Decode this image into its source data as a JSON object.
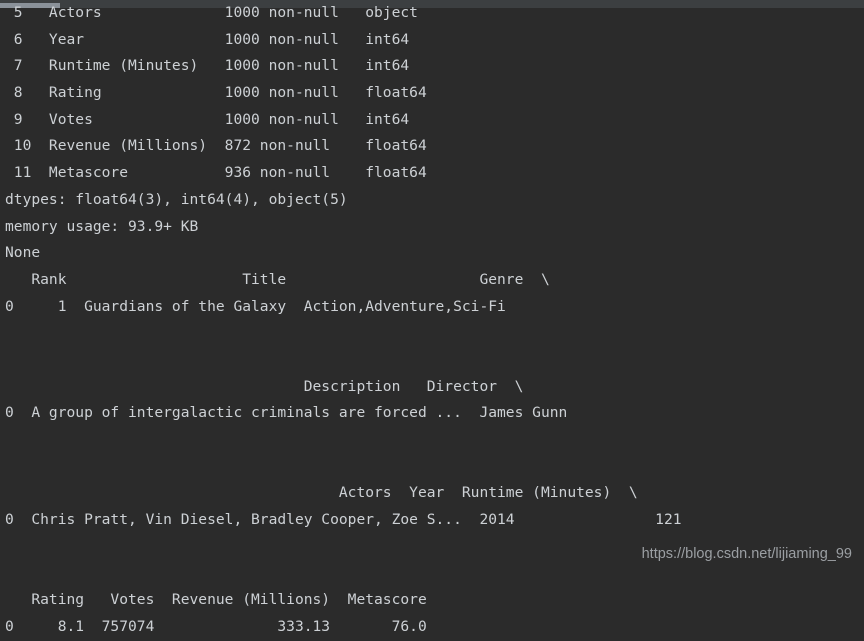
{
  "window": {
    "background_color": "#2b2b2b",
    "text_color": "#cdd1d5",
    "kind": "console-output"
  },
  "scrollbar": {
    "orientation": "horizontal",
    "track_color": "#3c3f41",
    "thumb_color": "#8a9199",
    "thumb_position_pct": 0,
    "thumb_width_pct": 7
  },
  "watermark": {
    "text": "https://blog.csdn.net/lijiaming_99",
    "color": "#9b9fa3"
  },
  "console": {
    "lines": [
      " 5   Actors              1000 non-null   object",
      " 6   Year                1000 non-null   int64",
      " 7   Runtime (Minutes)   1000 non-null   int64",
      " 8   Rating              1000 non-null   float64",
      " 9   Votes               1000 non-null   int64",
      " 10  Revenue (Millions)  872 non-null    float64",
      " 11  Metascore           936 non-null    float64",
      "dtypes: float64(3), int64(4), object(5)",
      "memory usage: 93.9+ KB",
      "None",
      "   Rank                    Title                      Genre  \\",
      "0     1  Guardians of the Galaxy  Action,Adventure,Sci-Fi",
      "",
      "",
      "                                  Description   Director  \\",
      "0  A group of intergalactic criminals are forced ...  James Gunn",
      "",
      "",
      "                                      Actors  Year  Runtime (Minutes)  \\",
      "0  Chris Pratt, Vin Diesel, Bradley Cooper, Zoe S...  2014                121",
      "",
      "",
      "   Rating   Votes  Revenue (Millions)  Metascore",
      "0     8.1  757074              333.13       76.0"
    ],
    "dataframe_info": {
      "columns": [
        {
          "index": "5",
          "name": "Actors",
          "non_null": "1000 non-null",
          "dtype": "object"
        },
        {
          "index": "6",
          "name": "Year",
          "non_null": "1000 non-null",
          "dtype": "int64"
        },
        {
          "index": "7",
          "name": "Runtime (Minutes)",
          "non_null": "1000 non-null",
          "dtype": "int64"
        },
        {
          "index": "8",
          "name": "Rating",
          "non_null": "1000 non-null",
          "dtype": "float64"
        },
        {
          "index": "9",
          "name": "Votes",
          "non_null": "1000 non-null",
          "dtype": "int64"
        },
        {
          "index": "10",
          "name": "Revenue (Millions)",
          "non_null": "872 non-null",
          "dtype": "float64"
        },
        {
          "index": "11",
          "name": "Metascore",
          "non_null": "936 non-null",
          "dtype": "float64"
        }
      ],
      "dtypes_summary": "dtypes: float64(3), int64(4), object(5)",
      "memory_usage": "memory usage: 93.9+ KB",
      "return_value": "None"
    },
    "dataframe_head": {
      "row_index": "0",
      "values": {
        "Rank": "1",
        "Title": "Guardians of the Galaxy",
        "Genre": "Action,Adventure,Sci-Fi",
        "Description": "A group of intergalactic criminals are forced ...",
        "Director": "James Gunn",
        "Actors": "Chris Pratt, Vin Diesel, Bradley Cooper, Zoe S...",
        "Year": "2014",
        "Runtime (Minutes)": "121",
        "Rating": "8.1",
        "Votes": "757074",
        "Revenue (Millions)": "333.13",
        "Metascore": "76.0"
      },
      "block_headers": [
        "   Rank                    Title                      Genre  \\",
        "                                  Description   Director  \\",
        "                                      Actors  Year  Runtime (Minutes)  \\",
        "   Rating   Votes  Revenue (Millions)  Metascore"
      ],
      "continuation_marker": "\\"
    }
  }
}
